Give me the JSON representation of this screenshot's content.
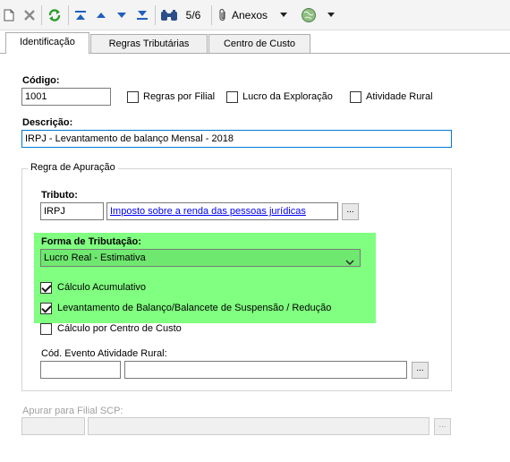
{
  "toolbar": {
    "record_position": "5/6",
    "anexos_label": "Anexos"
  },
  "tabs": [
    {
      "label": "Identificação",
      "active": true
    },
    {
      "label": "Regras Tributárias",
      "active": false
    },
    {
      "label": "Centro de Custo",
      "active": false
    }
  ],
  "form": {
    "codigo_label": "Código:",
    "codigo_value": "1001",
    "regras_por_filial_label": "Regras por Filial",
    "regras_por_filial_checked": false,
    "lucro_exploracao_label": "Lucro da Exploração",
    "lucro_exploracao_checked": false,
    "atividade_rural_label": "Atividade Rural",
    "atividade_rural_checked": false,
    "descricao_label": "Descrição:",
    "descricao_value": "IRPJ - Levantamento de balanço Mensal - 2018"
  },
  "regra_apuracao": {
    "group_label": "Regra de Apuração",
    "tributo_label": "Tributo:",
    "tributo_code": "IRPJ",
    "tributo_description": "Imposto sobre a renda das pessoas jurídicas",
    "browse_label": "...",
    "forma_tributacao_label": "Forma de Tributação:",
    "forma_tributacao_value": "Lucro Real - Estimativa",
    "calculo_acumulativo_label": "Cálculo Acumulativo",
    "calculo_acumulativo_checked": true,
    "levantamento_label": "Levantamento de Balanço/Balancete de Suspensão / Redução",
    "levantamento_checked": true,
    "calculo_centro_custo_label": "Cálculo por Centro de Custo",
    "calculo_centro_custo_checked": false,
    "cod_evento_label": "Cód. Evento Atividade Rural:",
    "cod_evento_code": "",
    "cod_evento_description": ""
  },
  "filial_scp": {
    "label": "Apurar para Filial SCP:",
    "code": "",
    "description": ""
  },
  "colors": {
    "highlight": "#80ff80",
    "input_focus_border": "#0078d7",
    "link": "#0000ee"
  }
}
